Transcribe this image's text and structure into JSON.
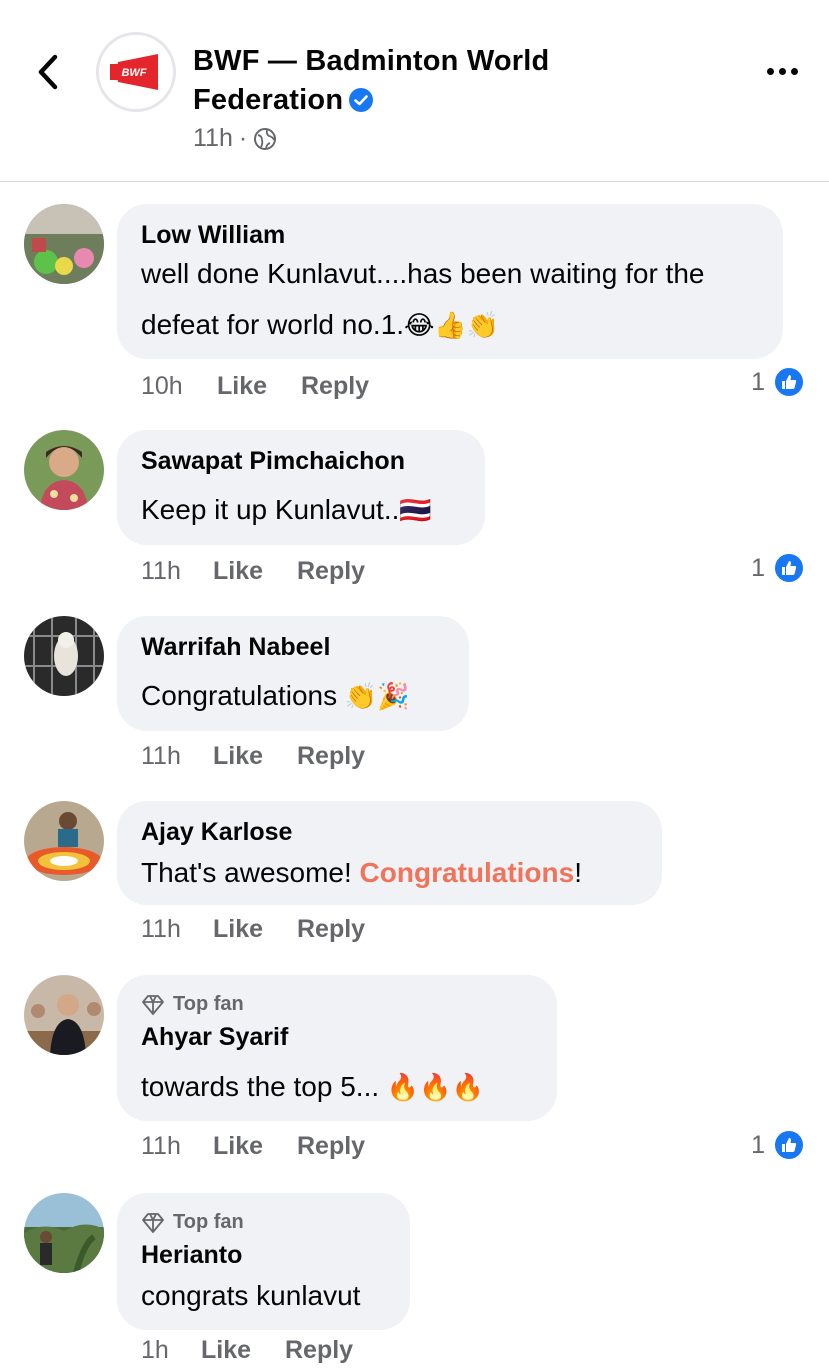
{
  "header": {
    "page_name": "BWF — Badminton World Federation",
    "page_name_line1": "BWF — Badminton World",
    "page_name_line2": "Federation",
    "time": "11h",
    "separator": "·",
    "logo_text": "BWF",
    "icons": {
      "back": "chevron-left-icon",
      "verified": "verified-badge-icon",
      "privacy": "globe-icon",
      "more": "more-options-icon"
    },
    "colors": {
      "logo_red": "#e4262c",
      "verified_blue": "#1877f2"
    }
  },
  "comments": [
    {
      "author": "Low William",
      "text_line1": "well done Kunlavut....has been waiting for the",
      "text_line2": "defeat for world no.1.",
      "emojis": "😂👍👏",
      "time": "10h",
      "like": "Like",
      "reply": "Reply",
      "reaction_count": "1"
    },
    {
      "author": "Sawapat Pimchaichon",
      "text": "Keep it up Kunlavut..",
      "emojis": "🇹🇭",
      "time": "11h",
      "like": "Like",
      "reply": "Reply",
      "reaction_count": "1"
    },
    {
      "author": "Warrifah Nabeel",
      "text": "Congratulations ",
      "emojis": "👏🎉",
      "time": "11h",
      "like": "Like",
      "reply": "Reply"
    },
    {
      "author": "Ajay Karlose",
      "text_before": "That's awesome! ",
      "text_highlight": "Congratulations",
      "text_after": "!",
      "time": "11h",
      "like": "Like",
      "reply": "Reply"
    },
    {
      "badge": "Top fan",
      "author": "Ahyar Syarif",
      "text": "towards the top 5... ",
      "emojis": "🔥🔥🔥",
      "time": "11h",
      "like": "Like",
      "reply": "Reply",
      "reaction_count": "1"
    },
    {
      "badge": "Top fan",
      "author": "Herianto",
      "text": "congrats kunlavut",
      "time": "1h",
      "like": "Like",
      "reply": "Reply"
    }
  ]
}
